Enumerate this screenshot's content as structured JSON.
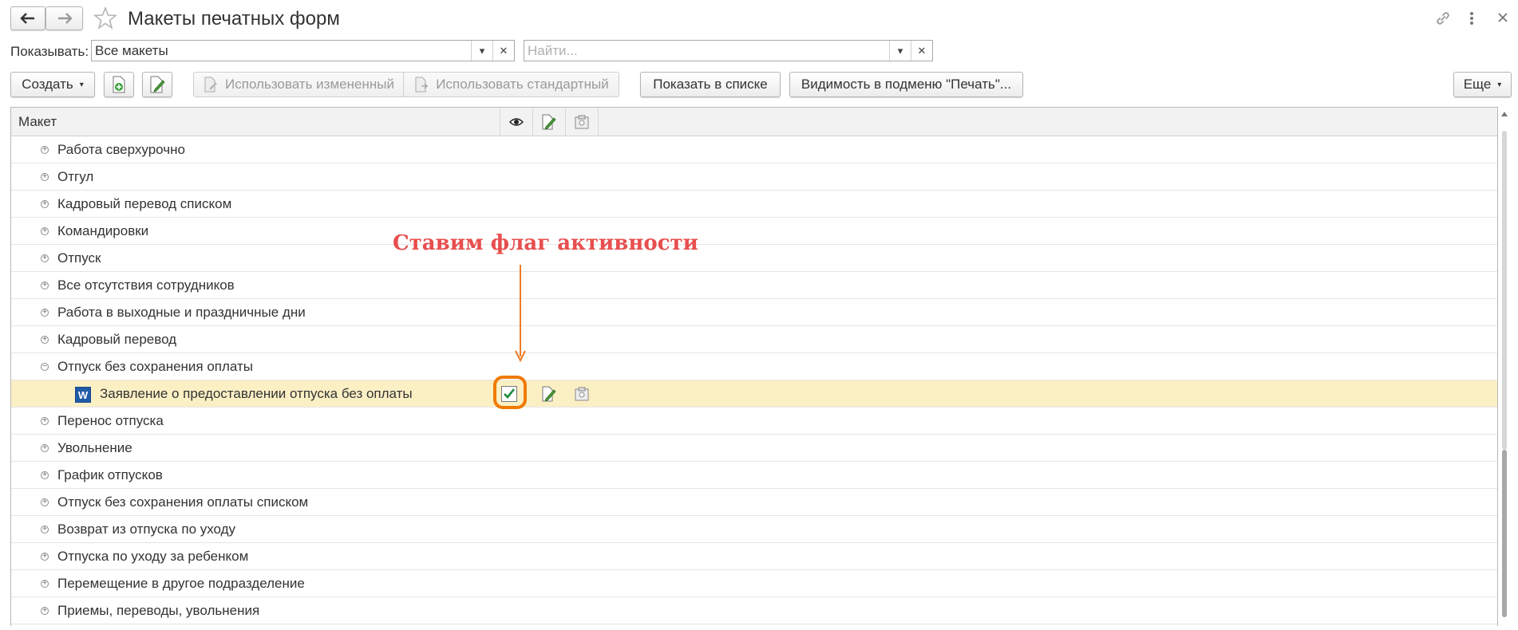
{
  "window": {
    "title": "Макеты печатных форм"
  },
  "filter": {
    "label": "Показывать:",
    "value": "Все макеты",
    "search_placeholder": "Найти..."
  },
  "toolbar": {
    "create": "Создать",
    "use_changed": "Использовать измененный",
    "use_standard": "Использовать стандартный",
    "show_in_list": "Показать в списке",
    "visibility": "Видимость в подменю \"Печать\"...",
    "more": "Еще"
  },
  "grid": {
    "column_header": "Макет",
    "rows": [
      {
        "label": "Работа сверхурочно",
        "expanded": false
      },
      {
        "label": "Отгул",
        "expanded": false
      },
      {
        "label": "Кадровый перевод списком",
        "expanded": false
      },
      {
        "label": "Командировки",
        "expanded": false
      },
      {
        "label": "Отпуск",
        "expanded": false
      },
      {
        "label": "Все отсутствия сотрудников",
        "expanded": false
      },
      {
        "label": "Работа в выходные и праздничные дни",
        "expanded": false
      },
      {
        "label": "Кадровый перевод",
        "expanded": false
      },
      {
        "label": "Отпуск без сохранения оплаты",
        "expanded": true
      },
      {
        "label": "Заявление о предоставлении отпуска без оплаты",
        "child": true,
        "selected": true,
        "checked": true
      },
      {
        "label": "Перенос отпуска",
        "expanded": false
      },
      {
        "label": "Увольнение",
        "expanded": false
      },
      {
        "label": "График отпусков",
        "expanded": false
      },
      {
        "label": "Отпуск без сохранения оплаты списком",
        "expanded": false
      },
      {
        "label": "Возврат из отпуска по уходу",
        "expanded": false
      },
      {
        "label": "Отпуска по уходу за ребенком",
        "expanded": false
      },
      {
        "label": "Перемещение в другое подразделение",
        "expanded": false
      },
      {
        "label": "Приемы, переводы, увольнения",
        "expanded": false
      }
    ]
  },
  "annotation": {
    "text": "Ставим флаг активности",
    "color": "#e84e4e",
    "arrow_color": "#f07a22"
  },
  "colors": {
    "selected_row": "#fbefc4",
    "highlight_ring": "#f07a00"
  }
}
